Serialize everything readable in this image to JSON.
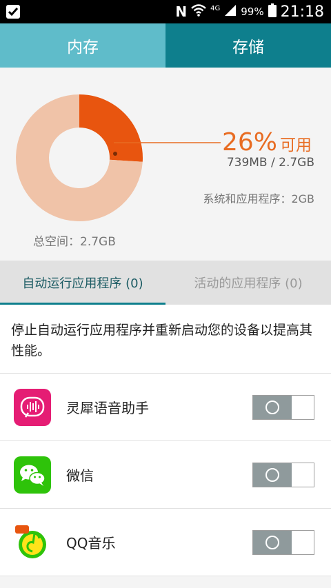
{
  "status_bar": {
    "time": "21:18",
    "battery": "99%",
    "network": "4G",
    "icons": [
      "task-check-icon",
      "nfc-icon",
      "wifi-icon",
      "signal-icon",
      "battery-icon"
    ]
  },
  "tabs": [
    {
      "label": "内存",
      "selected": true
    },
    {
      "label": "存储",
      "selected": false
    }
  ],
  "memory": {
    "percent_available": "26%",
    "available_word": "可用",
    "usage": "739MB / 2.7GB",
    "system_apps": "系统和应用程序：2GB",
    "total": "总空间：2.7GB"
  },
  "chart_data": {
    "type": "pie",
    "donut": true,
    "slices": [
      {
        "label": "可用",
        "value": 26,
        "color": "#e8550f"
      },
      {
        "label": "系统和应用程序",
        "value": 74,
        "color": "#f0c3a8"
      }
    ]
  },
  "subtabs": [
    {
      "label": "自动运行应用程序 (0)",
      "selected": true
    },
    {
      "label": "活动的应用程序 (0)",
      "selected": false
    }
  ],
  "description": "停止自动运行应用程序并重新启动您的设备以提高其性能。",
  "apps": [
    {
      "name": "灵犀语音助手",
      "icon": "voice-assistant-icon",
      "enabled": false
    },
    {
      "name": "微信",
      "icon": "wechat-icon",
      "enabled": false
    },
    {
      "name": "QQ音乐",
      "icon": "qq-music-icon",
      "enabled": false
    }
  ],
  "colors": {
    "tab_selected": "#5fbcca",
    "tab_unselected": "#0e7f8d",
    "accent_orange": "#e86c22"
  }
}
